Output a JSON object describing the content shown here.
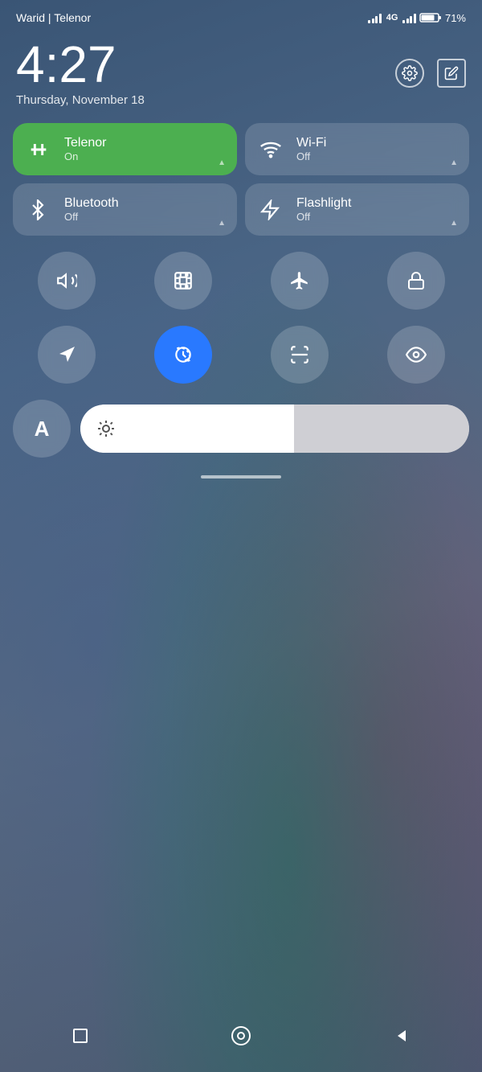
{
  "statusBar": {
    "carrier": "Warid | Telenor",
    "networkBadge": "4G",
    "batteryPercent": "71%"
  },
  "clock": {
    "time": "4:27",
    "date": "Thursday, November 18"
  },
  "tiles": [
    {
      "id": "telenor",
      "name": "Telenor",
      "status": "On",
      "active": true
    },
    {
      "id": "wifi",
      "name": "Wi-Fi",
      "status": "Off",
      "active": false
    },
    {
      "id": "bluetooth",
      "name": "Bluetooth",
      "status": "Off",
      "active": false
    },
    {
      "id": "flashlight",
      "name": "Flashlight",
      "status": "Off",
      "active": false
    }
  ],
  "iconButtons": [
    {
      "id": "bell",
      "label": "Mute",
      "active": false
    },
    {
      "id": "screenshot",
      "label": "Screenshot",
      "active": false
    },
    {
      "id": "airplane",
      "label": "Airplane Mode",
      "active": false
    },
    {
      "id": "lock",
      "label": "Lock",
      "active": false
    },
    {
      "id": "location",
      "label": "Location",
      "active": false
    },
    {
      "id": "autorotate",
      "label": "Auto Rotate",
      "active": true
    },
    {
      "id": "scan",
      "label": "Scan",
      "active": false
    },
    {
      "id": "privacy",
      "label": "Privacy",
      "active": false
    }
  ],
  "brightness": {
    "label": "A",
    "iconLabel": "brightness",
    "value": 55
  },
  "homeIndicator": "—",
  "navBar": {
    "back": "◀",
    "home": "○",
    "recents": "□"
  }
}
